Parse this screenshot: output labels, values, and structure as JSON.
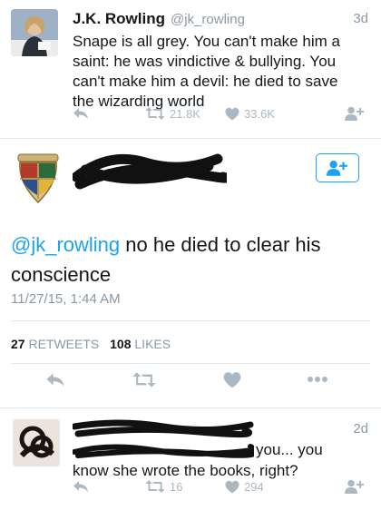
{
  "tweet1": {
    "name": "J.K. Rowling",
    "handle": "@jk_rowling",
    "time": "3d",
    "text": "Snape is all grey. You can't make him a saint: he was vindictive & bullying. You can't make him a devil: he died to save the wizarding world",
    "retweets": "21.8K",
    "likes": "33.6K"
  },
  "tweet2": {
    "mention": "@jk_rowling",
    "text": " no he died to clear his conscience",
    "timestamp": "11/27/15, 1:44 AM",
    "retweet_count": "27",
    "retweet_label": " RETWEETS",
    "like_count": "108",
    "like_label": " LIKES"
  },
  "tweet3": {
    "time": "2d",
    "text_line1": "you... you",
    "text_line2": "know she wrote the books, right?",
    "retweets": "16",
    "likes": "294"
  },
  "colors": {
    "accent": "#1da1f2",
    "muted": "#aab8c2",
    "text": "#14171a"
  },
  "icons": [
    "reply-icon",
    "retweet-icon",
    "heart-icon",
    "follow-icon",
    "more-icon"
  ]
}
